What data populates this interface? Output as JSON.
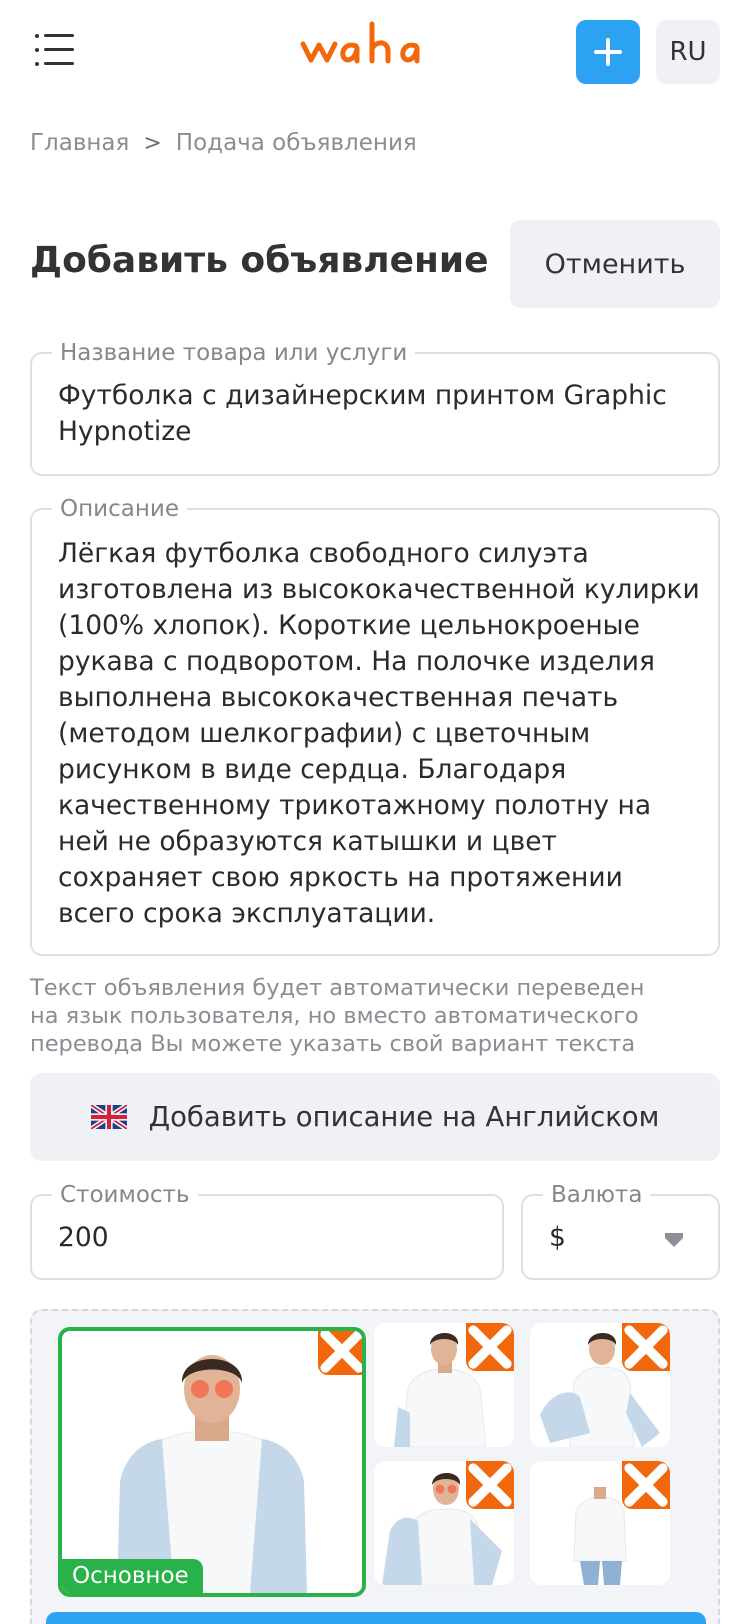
{
  "header": {
    "logo_text": "waha",
    "language": "RU",
    "colors": {
      "brand": "#f3670c",
      "accent": "#2ca3f2"
    }
  },
  "breadcrumb": {
    "home": "Главная",
    "separator": ">",
    "current": "Подача объявления"
  },
  "page": {
    "title": "Добавить объявление",
    "cancel_label": "Отменить"
  },
  "form": {
    "title_field": {
      "label": "Название товара или услуги",
      "value": "Футболка с дизайнерским принтом Graphic Hypnotize"
    },
    "description_field": {
      "label": "Описание",
      "value": "Лёгкая футболка свободного силуэта изготовлена из высококачественной кулирки (100% хлопок). Короткие цельнокроеные рукава с подворотом. На полочке изделия выполнена высококачественная печать (методом шелкографии) с цветочным рисунком в виде сердца. Благодаря качественному трикотажному полотну на ней не образуются катышки и цвет сохраняет свою яркость на протяжении всего срока эксплуатации."
    },
    "translation_hint": "Текст объявления будет автоматически переведен на язык пользователя, но вместо автоматического перевода Вы можете указать свой вариант текста",
    "add_english_label": "Добавить описание на Английском",
    "price_field": {
      "label": "Стоимость",
      "value": "200"
    },
    "currency_field": {
      "label": "Валюта",
      "value": "$"
    }
  },
  "photos": {
    "main_badge": "Основное",
    "items": [
      {
        "icon": "model-photo-main"
      },
      {
        "icon": "model-photo-2"
      },
      {
        "icon": "model-photo-3"
      },
      {
        "icon": "model-photo-4"
      },
      {
        "icon": "model-photo-5"
      }
    ]
  }
}
